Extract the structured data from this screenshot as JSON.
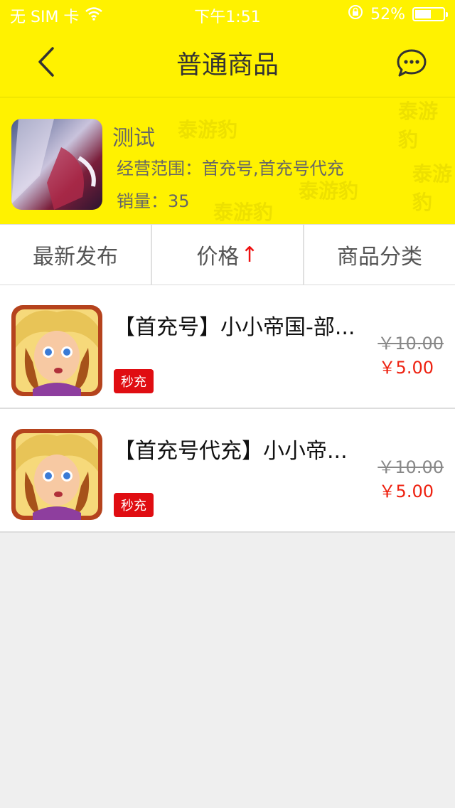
{
  "status_bar": {
    "carrier": "无 SIM 卡",
    "time": "下午1:51",
    "battery": "52%"
  },
  "nav": {
    "title": "普通商品"
  },
  "shop": {
    "name": "测试",
    "scope": "经营范围：首充号,首充号代充",
    "sales": "销量：35",
    "watermark": "泰游豹"
  },
  "tabs": [
    {
      "label": "最新发布"
    },
    {
      "label": "价格",
      "sort_arrow": "↑"
    },
    {
      "label": "商品分类"
    }
  ],
  "products": [
    {
      "title": "【首充号】小小帝国-部...",
      "badge": "秒充",
      "old_price": "￥10.00",
      "price": "￥5.00"
    },
    {
      "title": "【首充号代充】小小帝...",
      "badge": "秒充",
      "old_price": "￥10.00",
      "price": "￥5.00"
    }
  ],
  "colors": {
    "header_bg": "#fff200",
    "price_red": "#e21111",
    "badge_red": "#e00d12"
  }
}
